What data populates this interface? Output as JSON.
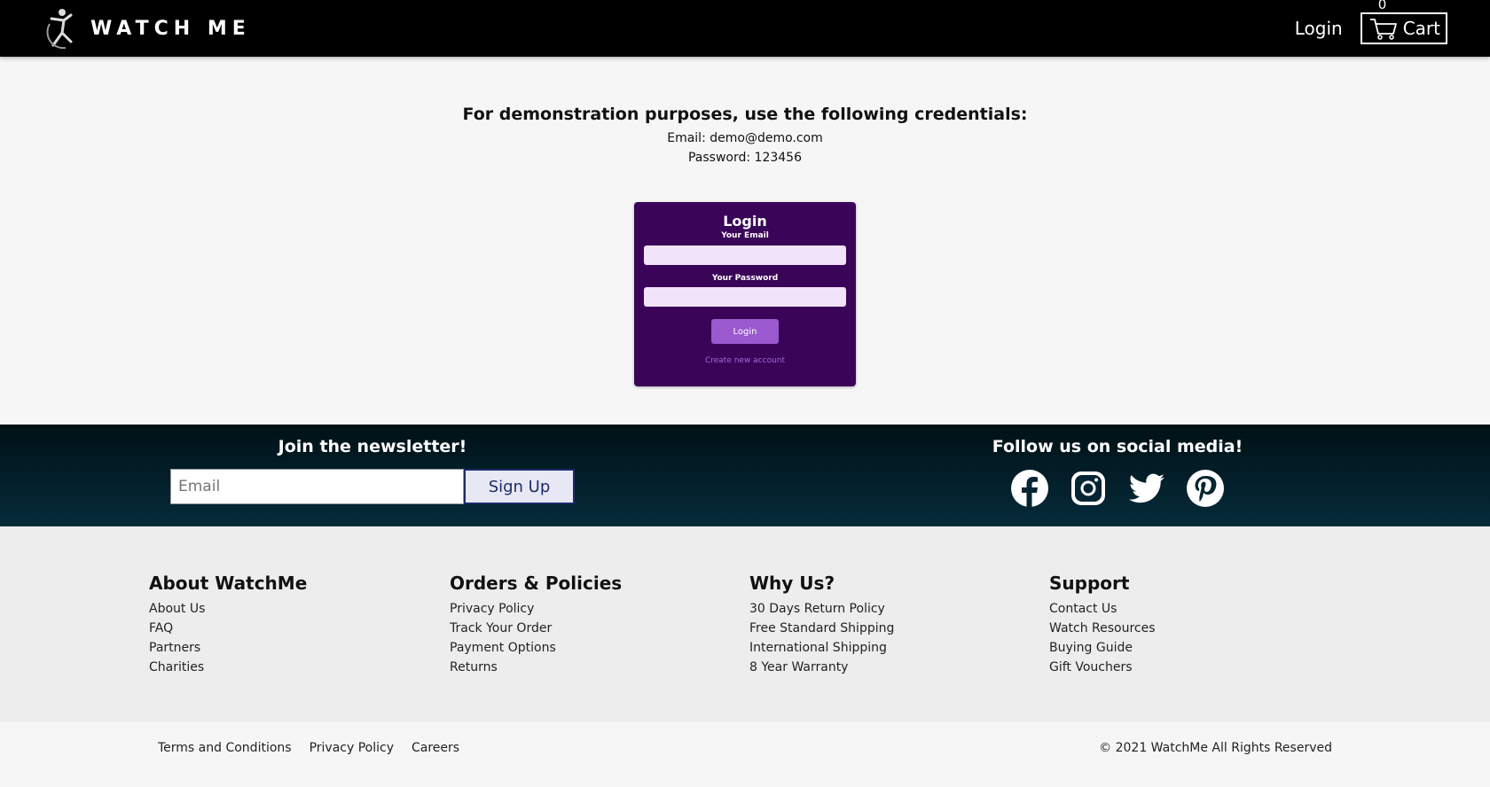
{
  "header": {
    "brand": "WATCH ME",
    "login_label": "Login",
    "cart_count": "0",
    "cart_label": "Cart"
  },
  "demo": {
    "title": "For demonstration purposes, use the following credentials:",
    "email_line": "Email: demo@demo.com",
    "password_line": "Password: 123456"
  },
  "login_card": {
    "title": "Login",
    "email_label": "Your Email",
    "password_label": "Your Password",
    "button_label": "Login",
    "create_account_label": "Create new account"
  },
  "newsletter": {
    "title": "Join the newsletter!",
    "email_placeholder": "Email",
    "button_label": "Sign Up"
  },
  "social": {
    "title": "Follow us on social media!",
    "icons": [
      "facebook-icon",
      "instagram-icon",
      "twitter-icon",
      "pinterest-icon"
    ]
  },
  "footer": {
    "columns": [
      {
        "title": "About WatchMe",
        "links": [
          "About Us",
          "FAQ",
          "Partners",
          "Charities"
        ]
      },
      {
        "title": "Orders & Policies",
        "links": [
          "Privacy Policy",
          "Track Your Order",
          "Payment Options",
          "Returns"
        ]
      },
      {
        "title": "Why Us?",
        "links": [
          "30 Days Return Policy",
          "Free Standard Shipping",
          "International Shipping",
          "8 Year Warranty"
        ]
      },
      {
        "title": "Support",
        "links": [
          "Contact Us",
          "Watch Resources",
          "Buying Guide",
          "Gift Vouchers"
        ]
      }
    ],
    "legal_links": [
      "Terms and Conditions",
      "Privacy Policy",
      "Careers"
    ],
    "copyright": "© 2021 WatchMe All Rights Reserved"
  },
  "colors": {
    "header_bg": "#000000",
    "card_bg": "#3a0558",
    "card_button": "#9b59cf",
    "newsletter_bg": "#031d27",
    "signup_border": "#1b2b6b"
  }
}
